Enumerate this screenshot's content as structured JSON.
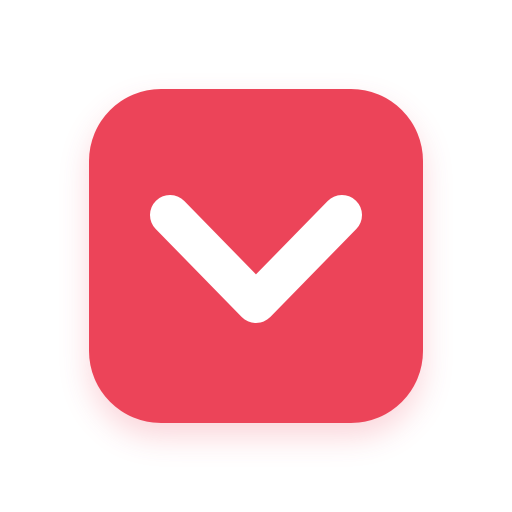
{
  "icon": {
    "name": "chevron-down-icon",
    "tile_color": "#EC4459",
    "glyph_color": "#FFFFFF",
    "background_color": "#FFFFFF"
  }
}
